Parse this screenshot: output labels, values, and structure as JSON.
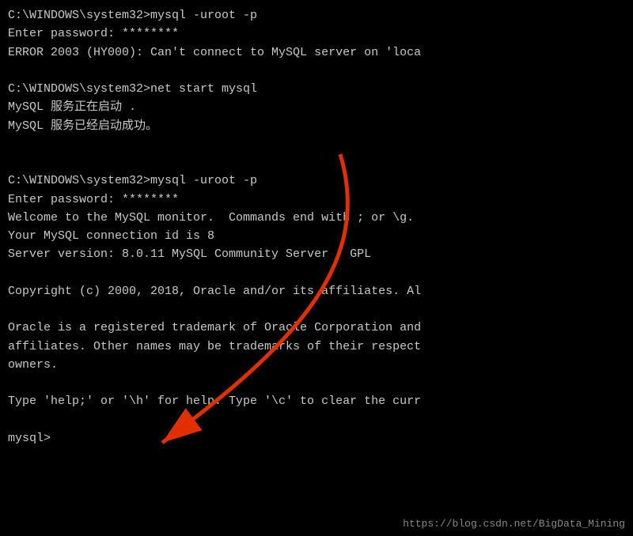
{
  "terminal": {
    "lines": [
      "C:\\WINDOWS\\system32>mysql -uroot -p",
      "Enter password: ********",
      "ERROR 2003 (HY000): Can't connect to MySQL server on 'loca",
      "",
      "C:\\WINDOWS\\system32>net start mysql",
      "MySQL 服务正在启动 .",
      "MySQL 服务已经启动成功。",
      "",
      "",
      "C:\\WINDOWS\\system32>mysql -uroot -p",
      "Enter password: ********",
      "Welcome to the MySQL monitor.  Commands end with ; or \\g.",
      "Your MySQL connection id is 8",
      "Server version: 8.0.11 MySQL Community Server - GPL",
      "",
      "Copyright (c) 2000, 2018, Oracle and/or its affiliates. Al",
      "",
      "Oracle is a registered trademark of Oracle Corporation and",
      "affiliates. Other names may be trademarks of their respect",
      "owners.",
      "",
      "Type 'help;' or '\\h' for help. Type '\\c' to clear the curr",
      "",
      "mysql>"
    ],
    "watermark": "https://blog.csdn.net/BigData_Mining"
  }
}
